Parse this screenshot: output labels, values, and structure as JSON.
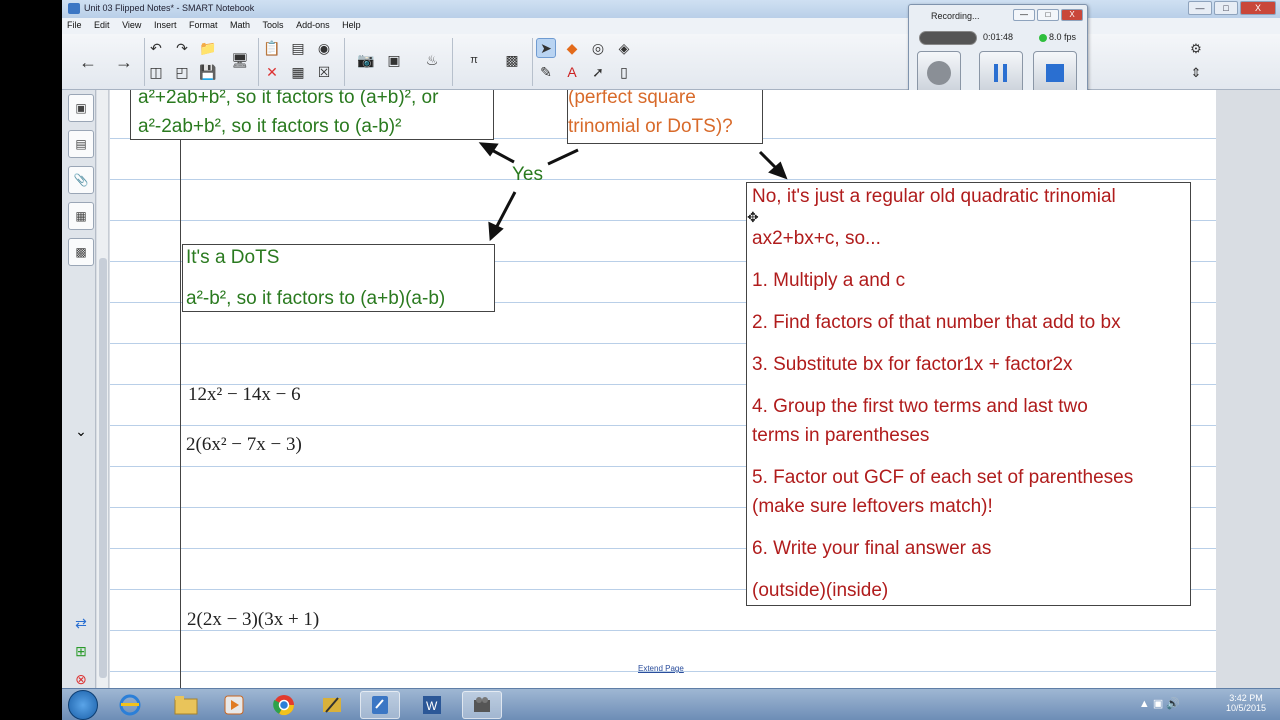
{
  "window": {
    "title": "Unit 03 Flipped Notes* - SMART Notebook",
    "controls": [
      "—",
      "□",
      "X"
    ]
  },
  "menu": [
    "File",
    "Edit",
    "View",
    "Insert",
    "Format",
    "Math",
    "Tools",
    "Add-ons",
    "Help"
  ],
  "recorder": {
    "title": "Recording...",
    "time": "0:01:48",
    "fps": "8.0 fps",
    "dropdown": "",
    "controls": [
      "—",
      "□",
      "X"
    ]
  },
  "canvas": {
    "top_left_box": {
      "line1": "a²+2ab+b², so it factors to (a+b)², or",
      "line2": "a²-2ab+b², so it factors to (a-b)²"
    },
    "top_mid_box": {
      "line1": "(perfect square",
      "line2": "trinomial or DoTS)?"
    },
    "yes_label": "Yes",
    "dots_box": {
      "line1": "It's a DoTS",
      "line2": "a²-b², so it factors to (a+b)(a-b)"
    },
    "steps_box": {
      "heading": "No, it's just a regular old quadratic trinomial",
      "line_form": "ax2+bx+c, so...",
      "step1": "1. Multiply a and c",
      "step2": "2. Find factors of that number that add to bx",
      "step3": "3. Substitute bx for factor1x + factor2x",
      "step4a": "4. Group the first two terms and last two",
      "step4b": "terms in parentheses",
      "step5a": "5. Factor out GCF of each set of parentheses",
      "step5b": "(make sure leftovers match)!",
      "step6a": "6. Write your final answer as",
      "step6b": "(outside)(inside)"
    },
    "math1": "12x² − 14x − 6",
    "math2": "2(6x² − 7x − 3)",
    "math3": "2(2x − 3)(3x + 1)",
    "extend_link": "Extend Page"
  },
  "taskbar": {
    "time": "3:42 PM",
    "date": "10/5/2015"
  }
}
